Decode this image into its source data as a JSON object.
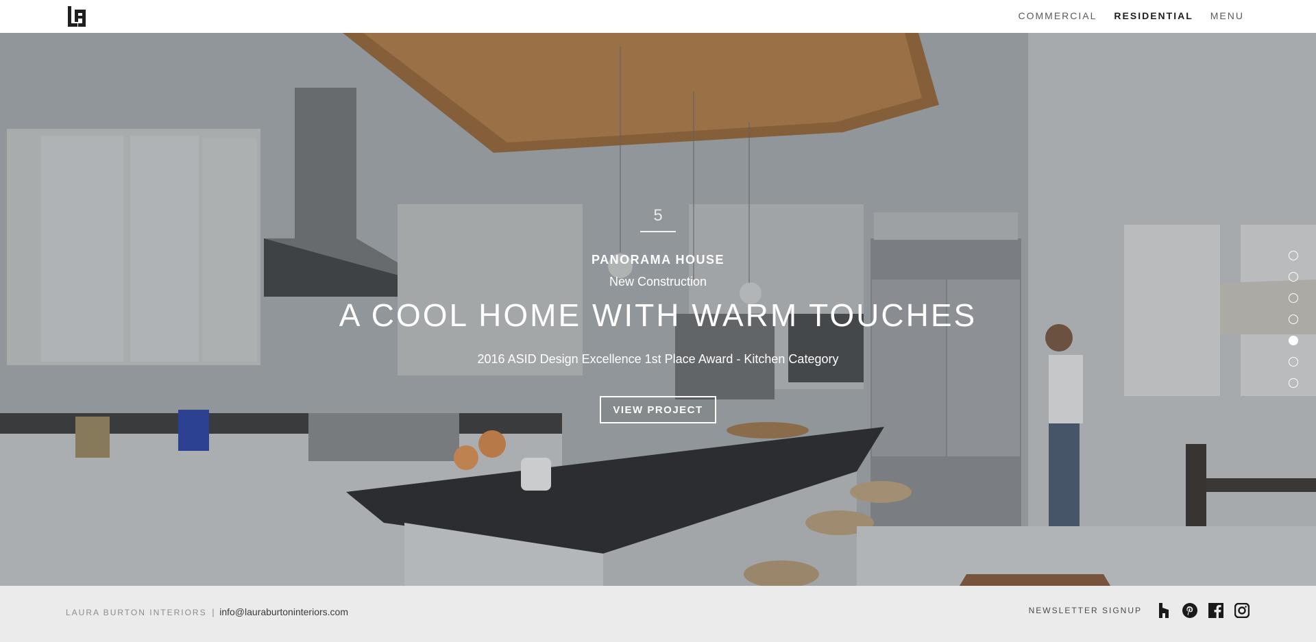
{
  "header": {
    "logo_alt": "LB",
    "nav": [
      {
        "label": "COMMERCIAL",
        "active": false
      },
      {
        "label": "RESIDENTIAL",
        "active": true
      },
      {
        "label": "MENU",
        "active": false
      }
    ]
  },
  "hero": {
    "slide_number": "5",
    "project_name": "PANORAMA HOUSE",
    "project_type": "New Construction",
    "headline": "A COOL HOME WITH WARM TOUCHES",
    "award": "2016 ASID Design Excellence 1st Place Award - Kitchen Category",
    "cta_label": "VIEW PROJECT",
    "pagination": {
      "total": 7,
      "active_index": 5
    }
  },
  "footer": {
    "brand": "LAURA BURTON INTERIORS",
    "separator": "|",
    "email": "info@lauraburtoninteriors.com",
    "newsletter_label": "NEWSLETTER SIGNUP",
    "social_icons": [
      "houzz-icon",
      "pinterest-icon",
      "facebook-icon",
      "instagram-icon"
    ]
  },
  "colors": {
    "header_bg": "#ffffff",
    "footer_bg": "#ebebeb",
    "nav_text": "#5a5a5a",
    "nav_active": "#1e1e1e",
    "hero_text": "#ffffff"
  }
}
